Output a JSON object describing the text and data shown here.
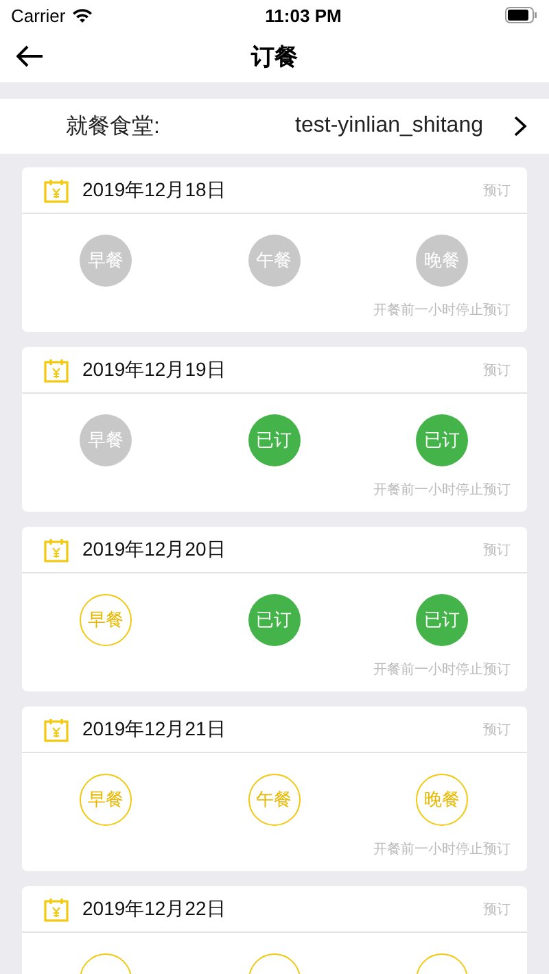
{
  "status_bar": {
    "carrier": "Carrier",
    "time": "11:03 PM"
  },
  "nav": {
    "title": "订餐"
  },
  "canteen": {
    "label": "就餐食堂:",
    "value": "test-yinlian_shitang"
  },
  "days": [
    {
      "date": "2019年12月18日",
      "action": "预订",
      "note": "开餐前一小时停止预订",
      "meals": [
        {
          "label": "早餐",
          "kind": "closed"
        },
        {
          "label": "午餐",
          "kind": "closed"
        },
        {
          "label": "晚餐",
          "kind": "closed"
        }
      ]
    },
    {
      "date": "2019年12月19日",
      "action": "预订",
      "note": "开餐前一小时停止预订",
      "meals": [
        {
          "label": "早餐",
          "kind": "closed"
        },
        {
          "label": "已订",
          "kind": "booked"
        },
        {
          "label": "已订",
          "kind": "booked"
        }
      ]
    },
    {
      "date": "2019年12月20日",
      "action": "预订",
      "note": "开餐前一小时停止预订",
      "meals": [
        {
          "label": "早餐",
          "kind": "available"
        },
        {
          "label": "已订",
          "kind": "booked"
        },
        {
          "label": "已订",
          "kind": "booked"
        }
      ]
    },
    {
      "date": "2019年12月21日",
      "action": "预订",
      "note": "开餐前一小时停止预订",
      "meals": [
        {
          "label": "早餐",
          "kind": "available"
        },
        {
          "label": "午餐",
          "kind": "available"
        },
        {
          "label": "晚餐",
          "kind": "available"
        }
      ]
    },
    {
      "date": "2019年12月22日",
      "action": "预订",
      "meals": [
        {
          "kind": "available"
        },
        {
          "kind": "available"
        },
        {
          "kind": "available"
        }
      ]
    }
  ]
}
